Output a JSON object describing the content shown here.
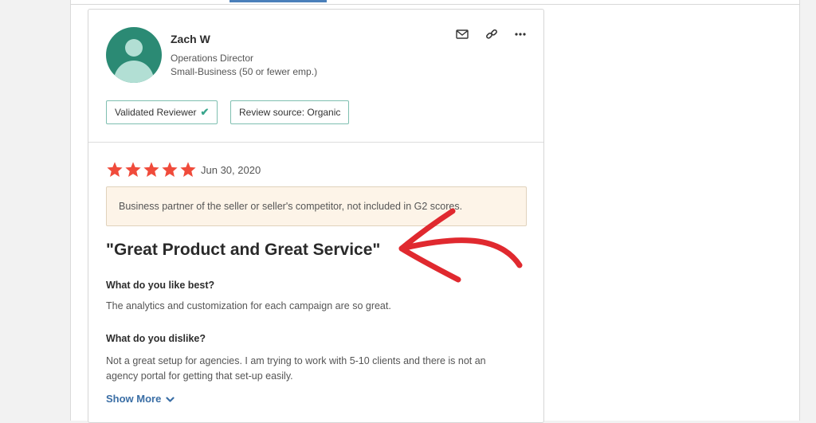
{
  "reviewer": {
    "name": "Zach W",
    "title": "Operations Director",
    "segment": "Small-Business (50 or fewer emp.)"
  },
  "actions": {
    "icons": [
      "mail-icon",
      "link-icon",
      "more-options-icon"
    ]
  },
  "badges": {
    "validated": "Validated Reviewer",
    "validated_icon": "checkmark-icon",
    "source": "Review source: Organic"
  },
  "review": {
    "rating": 5,
    "rating_max": 5,
    "date": "Jun 30, 2020",
    "notice": "Business partner of the seller or seller's competitor, not included in G2 scores.",
    "title": "\"Great Product and Great Service\"",
    "questions": [
      {
        "question": "What do you like best?",
        "answer": "The analytics and customization for each campaign are so great."
      },
      {
        "question": "What do you dislike?",
        "answer": "Not a great setup for agencies. I am trying to work with 5-10 clients and there is not an agency portal for getting that set-up easily."
      }
    ],
    "show_more": "Show More"
  },
  "colors": {
    "star": "#f04b3b",
    "accent": "#3a6ea5",
    "badge_border": "#7fbfb0",
    "avatar": "#2b8a74",
    "annotation": "#e0292f",
    "notice_bg": "#fdf4e8"
  }
}
